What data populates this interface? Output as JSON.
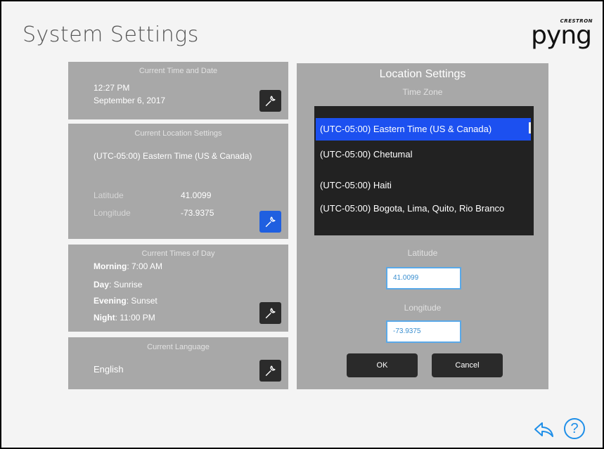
{
  "header": {
    "title": "System Settings",
    "logo_brand": "CRESTRON",
    "logo_name": "pyng"
  },
  "time_card": {
    "heading": "Current Time and Date",
    "time": "12:27 PM",
    "date": "September 6, 2017"
  },
  "location_card": {
    "heading": "Current Location Settings",
    "timezone": "(UTC-05:00) Eastern Time (US & Canada)",
    "latitude_label": "Latitude",
    "latitude_value": "41.0099",
    "longitude_label": "Longitude",
    "longitude_value": "-73.9375"
  },
  "times_card": {
    "heading": "Current Times of Day",
    "rows": [
      {
        "label": "Morning",
        "value": ": 7:00 AM"
      },
      {
        "label": "Day",
        "value": ": Sunrise"
      },
      {
        "label": "Evening",
        "value": ": Sunset"
      },
      {
        "label": "Night",
        "value": ": 11:00 PM"
      }
    ]
  },
  "language_card": {
    "heading": "Current Language",
    "value": "English"
  },
  "location_panel": {
    "title": "Location Settings",
    "timezone_label": "Time Zone",
    "timezones": [
      "(UTC-05:00) Eastern Time (US & Canada)",
      "(UTC-05:00) Chetumal",
      "(UTC-05:00) Haiti",
      "(UTC-05:00) Bogota, Lima, Quito, Rio Branco"
    ],
    "selected_index": 0,
    "latitude_label": "Latitude",
    "latitude_value": "41.0099",
    "longitude_label": "Longitude",
    "longitude_value": "-73.9375",
    "ok_label": "OK",
    "cancel_label": "Cancel"
  },
  "icons": [
    "wrench-icon",
    "back-arrow-icon",
    "help-icon"
  ],
  "colors": {
    "accent_blue": "#1f5fe0",
    "selection_blue": "#1c50f0",
    "help_blue": "#1f8fe8",
    "card_gray": "#a8a8a8"
  }
}
